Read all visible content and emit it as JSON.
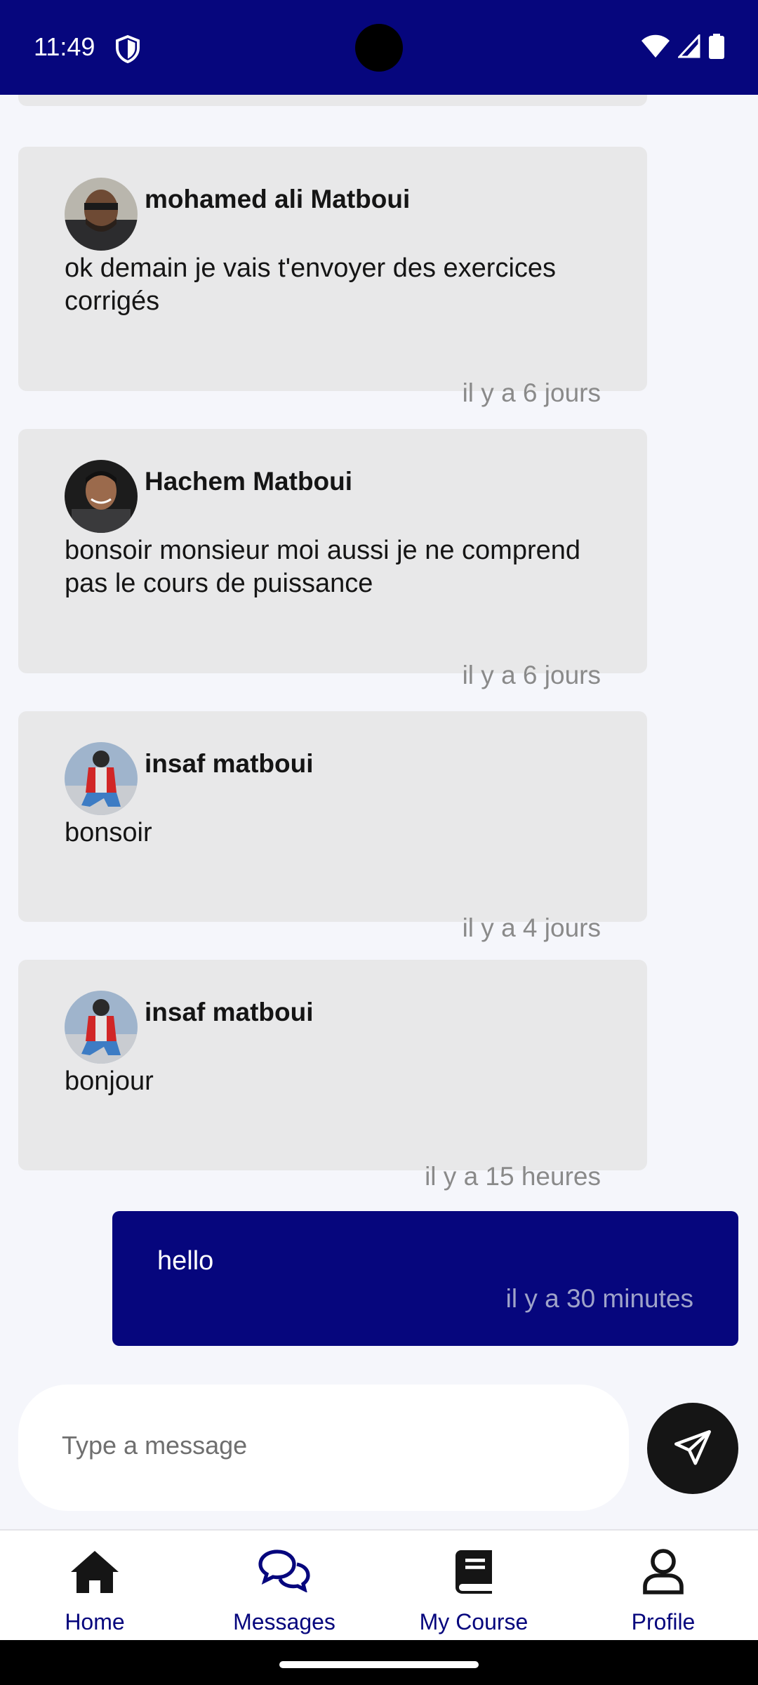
{
  "status_bar": {
    "time": "11:49"
  },
  "messages": [
    {
      "sender": "mohamed ali Matboui",
      "text": "ok demain je vais t'envoyer des exercices corrigés",
      "time": "il y a 6 jours"
    },
    {
      "sender": "Hachem Matboui",
      "text": "bonsoir monsieur moi aussi je ne comprend pas le cours de puissance",
      "time": "il y a 6 jours"
    },
    {
      "sender": "insaf matboui",
      "text": "bonsoir",
      "time": "il y a 4 jours"
    },
    {
      "sender": "insaf matboui",
      "text": "bonjour",
      "time": "il y a 15 heures"
    }
  ],
  "my_message": {
    "text": "hello",
    "time": "il y a 30 minutes"
  },
  "composer": {
    "placeholder": "Type a message"
  },
  "nav": {
    "items": [
      {
        "label": "Home",
        "icon": "home-icon"
      },
      {
        "label": "Messages",
        "icon": "chat-icon"
      },
      {
        "label": "My Course",
        "icon": "book-icon"
      },
      {
        "label": "Profile",
        "icon": "user-icon"
      }
    ],
    "active": "Messages"
  },
  "colors": {
    "primary": "#06067d",
    "card": "#e8e8e9",
    "background": "#f5f6fb"
  }
}
